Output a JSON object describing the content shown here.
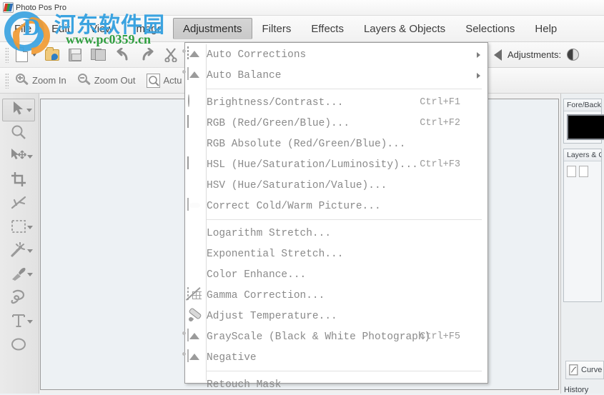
{
  "window": {
    "title": "Photo Pos Pro",
    "app_icon": "photo-pos-pro-icon"
  },
  "watermark": {
    "logo_letter": "D",
    "site_cn": "河东软件园",
    "site_url": "www.pc0359.cn",
    "color_blue": "#3ba3e0",
    "color_orange": "#f09a33",
    "color_green": "#2f9e3f"
  },
  "menubar": {
    "items": [
      {
        "label": "File",
        "active": false
      },
      {
        "label": "Edit",
        "active": false
      },
      {
        "label": "View",
        "active": false
      },
      {
        "label": "Image",
        "active": false
      },
      {
        "label": "Adjustments",
        "active": true
      },
      {
        "label": "Filters",
        "active": false
      },
      {
        "label": "Effects",
        "active": false
      },
      {
        "label": "Layers & Objects",
        "active": false
      },
      {
        "label": "Selections",
        "active": false
      },
      {
        "label": "Help",
        "active": false
      }
    ]
  },
  "toolbar_main": {
    "buttons": [
      {
        "name": "new-document-button",
        "icon": "new-page-icon",
        "label": "",
        "has_caret": true
      },
      {
        "name": "open-file-button",
        "icon": "open-folder-icon",
        "label": "",
        "has_caret": false
      },
      {
        "name": "save-button",
        "icon": "save-icon",
        "label": "",
        "has_caret": false
      },
      {
        "name": "save-as-button",
        "icon": "save-as-icon",
        "label": "",
        "has_caret": false
      },
      {
        "name": "undo-button",
        "icon": "undo-arrow-icon",
        "label": "",
        "has_caret": false
      },
      {
        "name": "redo-button",
        "icon": "redo-arrow-icon",
        "label": "",
        "has_caret": false
      },
      {
        "name": "cut-button",
        "icon": "scissors-icon",
        "label": "",
        "has_caret": false
      },
      {
        "name": "copy-button",
        "icon": "copy-icon",
        "label": "",
        "has_caret": false
      }
    ]
  },
  "toolbar_zoom": {
    "buttons": [
      {
        "name": "zoom-in-button",
        "icon": "magnifier-plus-icon",
        "label": "Zoom In"
      },
      {
        "name": "zoom-out-button",
        "icon": "magnifier-minus-icon",
        "label": "Zoom Out"
      },
      {
        "name": "actual-size-button",
        "icon": "document-zoom-icon",
        "label": "Actu"
      }
    ]
  },
  "tools_panel": {
    "tools": [
      {
        "name": "selection-arrow-tool",
        "icon": "cursor-arrow-icon",
        "selected": true,
        "caret": true
      },
      {
        "name": "zoom-tool",
        "icon": "magnifier-icon",
        "selected": false,
        "caret": false
      },
      {
        "name": "move-tool",
        "icon": "move-arrow-icon",
        "selected": false,
        "caret": true
      },
      {
        "name": "crop-tool",
        "icon": "crop-icon",
        "selected": false,
        "caret": false
      },
      {
        "name": "slice-tool",
        "icon": "slice-icon",
        "selected": false,
        "caret": false
      },
      {
        "name": "rect-select-tool",
        "icon": "marquee-rect-icon",
        "selected": false,
        "caret": true
      },
      {
        "name": "magic-wand-tool",
        "icon": "magic-wand-icon",
        "selected": false,
        "caret": true
      },
      {
        "name": "eyedropper-tool",
        "icon": "eyedropper-icon",
        "selected": false,
        "caret": true
      },
      {
        "name": "lasso-tool",
        "icon": "lasso-icon",
        "selected": false,
        "caret": false
      },
      {
        "name": "text-tool",
        "icon": "text-t-icon",
        "selected": false,
        "caret": true
      },
      {
        "name": "shape-tool",
        "icon": "ellipse-shape-icon",
        "selected": false,
        "caret": false
      }
    ]
  },
  "right_toolbar": {
    "overflow_arrow": "chevron-right-icon",
    "back_arrow_icon": "back-triangle-icon",
    "label": "Adjustments:",
    "brightness_icon": "brightness-half-circle-icon"
  },
  "right_dock": {
    "panels": [
      {
        "name": "fore-back-panel",
        "title": "Fore/Back S",
        "swatch_color": "#000000"
      },
      {
        "name": "layers-objects-panel",
        "title": "Layers & Ob"
      }
    ],
    "curve_button": {
      "label": "Curve",
      "icon": "curve-document-icon"
    },
    "history_label": "History"
  },
  "dropdown": {
    "owner": "Adjustments",
    "items": [
      {
        "type": "item",
        "label": "Auto Corrections",
        "accel": "",
        "icon": "auto-corrections-photo-icon",
        "submenu": true
      },
      {
        "type": "item",
        "label": "Auto Balance",
        "accel": "",
        "icon": "auto-balance-photo-icon",
        "submenu": true
      },
      {
        "type": "separator"
      },
      {
        "type": "item",
        "label": "Brightness/Contrast...",
        "accel": "Ctrl+F1",
        "icon": "brightness-half-circle-icon",
        "submenu": false
      },
      {
        "type": "item",
        "label": "RGB (Red/Green/Blue)...",
        "accel": "Ctrl+F2",
        "icon": "rgb-bars-icon",
        "submenu": false
      },
      {
        "type": "item",
        "label": "RGB Absolute (Red/Green/Blue)...",
        "accel": "",
        "icon": "",
        "submenu": false
      },
      {
        "type": "item",
        "label": "HSL (Hue/Saturation/Luminosity)...",
        "accel": "Ctrl+F3",
        "icon": "hsl-bars-icon",
        "submenu": false
      },
      {
        "type": "item",
        "label": "HSV (Hue/Saturation/Value)...",
        "accel": "",
        "icon": "",
        "submenu": false
      },
      {
        "type": "item",
        "label": "Correct Cold/Warm Picture...",
        "accel": "",
        "icon": "cold-warm-cloud-icon",
        "submenu": false
      },
      {
        "type": "separator"
      },
      {
        "type": "item",
        "label": "Logarithm Stretch...",
        "accel": "",
        "icon": "",
        "submenu": false
      },
      {
        "type": "item",
        "label": "Exponential Stretch...",
        "accel": "",
        "icon": "",
        "submenu": false
      },
      {
        "type": "item",
        "label": "Color Enhance...",
        "accel": "",
        "icon": "",
        "submenu": false
      },
      {
        "type": "item",
        "label": "Gamma Correction...",
        "accel": "",
        "icon": "gamma-curve-icon",
        "submenu": false
      },
      {
        "type": "item",
        "label": "Adjust Temperature...",
        "accel": "",
        "icon": "thermometer-icon",
        "submenu": false
      },
      {
        "type": "item",
        "label": "GrayScale (Black & White Photograph)",
        "accel": "Ctrl+F5",
        "icon": "grayscale-photo-icon",
        "submenu": false
      },
      {
        "type": "item",
        "label": "Negative",
        "accel": "",
        "icon": "negative-photo-icon",
        "submenu": false
      },
      {
        "type": "separator"
      },
      {
        "type": "item",
        "label": "Retouch Mask",
        "accel": "",
        "icon": "",
        "submenu": false
      }
    ]
  }
}
